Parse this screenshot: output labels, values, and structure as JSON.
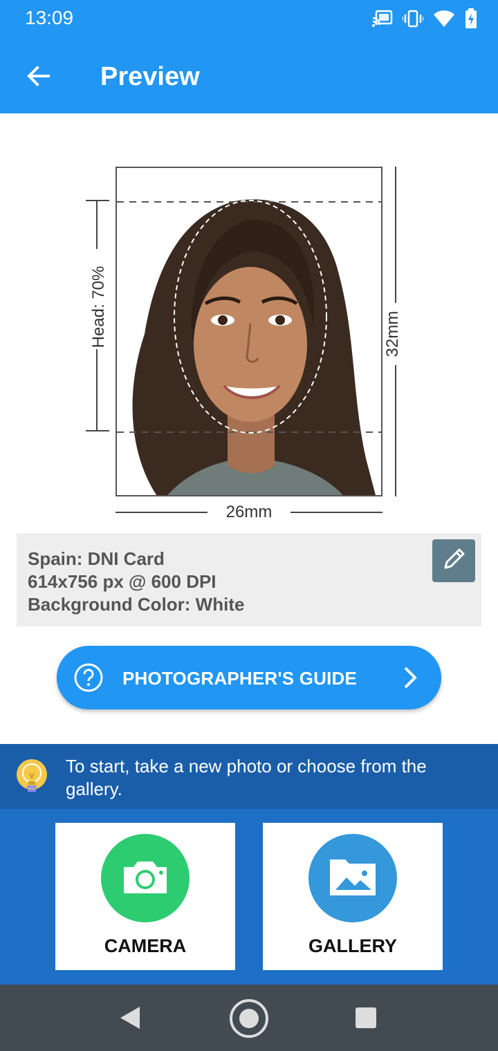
{
  "status_bar": {
    "time": "13:09",
    "icons": [
      "cast-icon",
      "vibrate-icon",
      "wifi-icon",
      "battery-charging-icon"
    ]
  },
  "app_bar": {
    "title": "Preview",
    "back_icon": "arrow-back-icon"
  },
  "diagram": {
    "head_label": "Head: 70%",
    "height_label": "32mm",
    "width_label": "26mm"
  },
  "document_info": {
    "line1": "Spain: DNI Card",
    "line2": "614x756 px @ 600 DPI",
    "line3": "Background Color: White",
    "edit_icon": "pencil-icon"
  },
  "guide_button": {
    "label": "PHOTOGRAPHER'S GUIDE",
    "icon": "help-circle-icon",
    "chevron": "chevron-right-icon"
  },
  "tip": {
    "text": "To start, take a new photo or choose from the gallery.",
    "icon": "lightbulb-icon"
  },
  "actions": {
    "camera": {
      "label": "CAMERA",
      "icon": "camera-icon",
      "color": "#2ecc71"
    },
    "gallery": {
      "label": "GALLERY",
      "icon": "gallery-folder-icon",
      "color": "#3498db"
    }
  },
  "nav_bar": {
    "icons": [
      "nav-back-icon",
      "nav-home-icon",
      "nav-recents-icon"
    ]
  },
  "colors": {
    "primary": "#2196F3",
    "tip_bg": "#1a5eaa",
    "bottom_bg": "#1e6fc6",
    "nav_bg": "#424a52"
  }
}
